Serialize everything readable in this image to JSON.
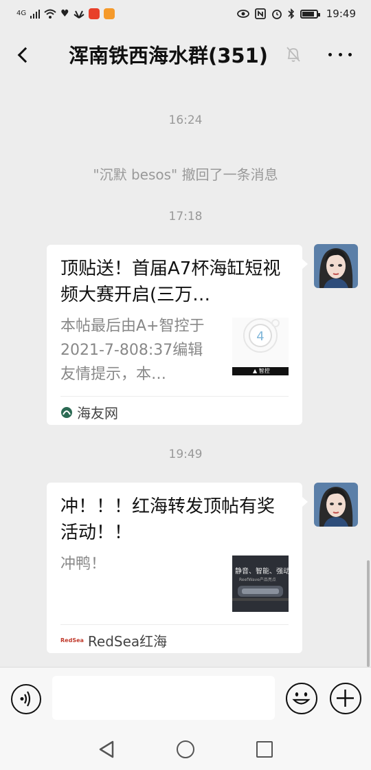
{
  "status_bar": {
    "network": "4G",
    "time": "19:49"
  },
  "header": {
    "title": "浑南铁西海水群(351)"
  },
  "chat": {
    "timestamps": [
      "16:24",
      "17:18",
      "19:49"
    ],
    "system_message": "\"沉默 besos\" 撤回了一条消息",
    "messages": [
      {
        "title": "顶贴送！首届A7杯海缸短视频大赛开启(三万…",
        "description": "本帖最后由A+智控于2021-7-808:37编辑友情提示，本…",
        "source": "海友网",
        "thumb_bar_text": "▲ 智控"
      },
      {
        "title": "冲！！！红海转发顶帖有奖活动！！",
        "description": "冲鸭！",
        "source": "RedSea红海",
        "source_logo_text": "RedSea",
        "thumb_text": "静音、智能、强动",
        "thumb_subtext": "ReefWave产品亮点"
      }
    ]
  },
  "colors": {
    "background": "#ededed",
    "card": "#ffffff",
    "muted_text": "#999999"
  }
}
